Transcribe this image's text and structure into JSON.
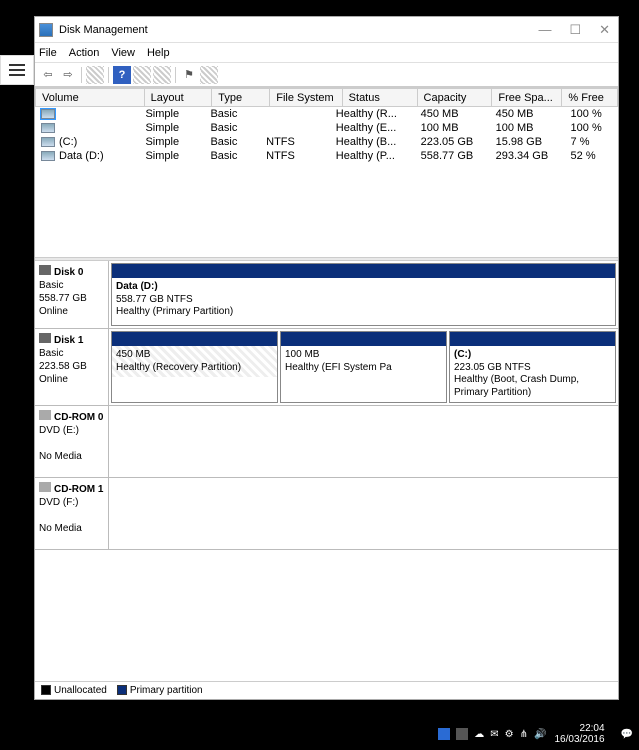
{
  "window": {
    "title": "Disk Management",
    "controls": {
      "minimize": "—",
      "maximize": "☐",
      "close": "✕"
    }
  },
  "menubar": [
    "File",
    "Action",
    "View",
    "Help"
  ],
  "toolbar": {
    "back": "⇦",
    "fwd": "⇨",
    "up": "⤒",
    "sep": "|",
    "refresh": "⟳",
    "help": "?",
    "props": "⧉",
    "list": "≣",
    "tree": "☰"
  },
  "columns": [
    "Volume",
    "Layout",
    "Type",
    "File System",
    "Status",
    "Capacity",
    "Free Spa...",
    "% Free"
  ],
  "volumes": [
    {
      "name": "",
      "layout": "Simple",
      "vtype": "Basic",
      "fs": "",
      "status": "Healthy (R...",
      "cap": "450 MB",
      "free": "450 MB",
      "pct": "100 %"
    },
    {
      "name": "",
      "layout": "Simple",
      "vtype": "Basic",
      "fs": "",
      "status": "Healthy (E...",
      "cap": "100 MB",
      "free": "100 MB",
      "pct": "100 %"
    },
    {
      "name": "(C:)",
      "layout": "Simple",
      "vtype": "Basic",
      "fs": "NTFS",
      "status": "Healthy (B...",
      "cap": "223.05 GB",
      "free": "15.98 GB",
      "pct": "7 %"
    },
    {
      "name": "Data (D:)",
      "layout": "Simple",
      "vtype": "Basic",
      "fs": "NTFS",
      "status": "Healthy (P...",
      "cap": "558.77 GB",
      "free": "293.34 GB",
      "pct": "52 %"
    }
  ],
  "disks": [
    {
      "name": "Disk 0",
      "dtype": "Basic",
      "size": "558.77 GB",
      "state": "Online",
      "parts": [
        {
          "title": "Data  (D:)",
          "sub": "558.77 GB NTFS",
          "status": "Healthy (Primary Partition)",
          "hatched": false
        }
      ]
    },
    {
      "name": "Disk 1",
      "dtype": "Basic",
      "size": "223.58 GB",
      "state": "Online",
      "parts": [
        {
          "title": "",
          "sub": "450 MB",
          "status": "Healthy (Recovery Partition)",
          "hatched": true
        },
        {
          "title": "",
          "sub": "100 MB",
          "status": "Healthy (EFI System Pa",
          "hatched": false
        },
        {
          "title": "(C:)",
          "sub": "223.05 GB NTFS",
          "status": "Healthy (Boot, Crash Dump, Primary Partition)",
          "hatched": false
        }
      ]
    },
    {
      "name": "CD-ROM 0",
      "dtype": "DVD (E:)",
      "size": "",
      "state": "No Media",
      "parts": []
    },
    {
      "name": "CD-ROM 1",
      "dtype": "DVD (F:)",
      "size": "",
      "state": "No Media",
      "parts": []
    }
  ],
  "legend": {
    "unalloc": "Unallocated",
    "primary": "Primary partition"
  },
  "taskbar": {
    "time": "22:04",
    "date": "16/03/2016"
  }
}
